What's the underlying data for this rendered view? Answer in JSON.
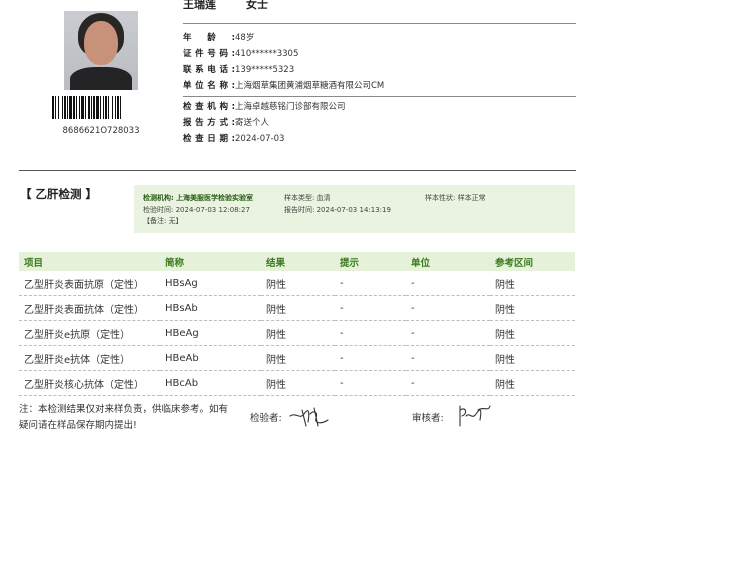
{
  "patient": {
    "name": "王瑞莲",
    "gender": "女士",
    "barcode_number": "8686621O728033"
  },
  "info": [
    {
      "label": "年龄:",
      "value": "48岁"
    },
    {
      "label": "证件号码:",
      "value": "410******3305"
    },
    {
      "label": "联系电话:",
      "value": "139*****5323"
    },
    {
      "label": "单位名称:",
      "value": "上海烟草集团黄浦烟草糖酒有限公司CM"
    }
  ],
  "exam": [
    {
      "label": "检查机构:",
      "value": "上海卓越慈铭门诊部有限公司"
    },
    {
      "label": "报告方式:",
      "value": "寄送个人"
    },
    {
      "label": "检查日期:",
      "value": "2024-07-03"
    }
  ],
  "section": {
    "title": "【 乙肝检测 】",
    "summary": {
      "lab_label": "检测机构:",
      "lab": "上海美服医学检验实验室",
      "sample_type": "样本类型: 血清",
      "sample_status": "样本性状: 样本正常",
      "test_time": "检验时间: 2024-07-03 12:08:27",
      "report_time": "报告时间: 2024-07-03 14:13:19",
      "note": "【备注: 无】"
    }
  },
  "table": {
    "headers": [
      "项目",
      "简称",
      "结果",
      "提示",
      "单位",
      "参考区间"
    ],
    "rows": [
      [
        "乙型肝炎表面抗原（定性）",
        "HBsAg",
        "阴性",
        "-",
        "-",
        "阴性"
      ],
      [
        "乙型肝炎表面抗体（定性）",
        "HBsAb",
        "阴性",
        "-",
        "-",
        "阴性"
      ],
      [
        "乙型肝炎e抗原（定性）",
        "HBeAg",
        "阴性",
        "-",
        "-",
        "阴性"
      ],
      [
        "乙型肝炎e抗体（定性）",
        "HBeAb",
        "阴性",
        "-",
        "-",
        "阴性"
      ],
      [
        "乙型肝炎核心抗体（定性）",
        "HBcAb",
        "阴性",
        "-",
        "-",
        "阴性"
      ]
    ]
  },
  "footer": {
    "note": "注：本检测结果仅对来样负责，供临床参考。如有疑问请在样品保存期内提出!",
    "inspector_label": "检验者:",
    "reviewer_label": "审核者:"
  }
}
